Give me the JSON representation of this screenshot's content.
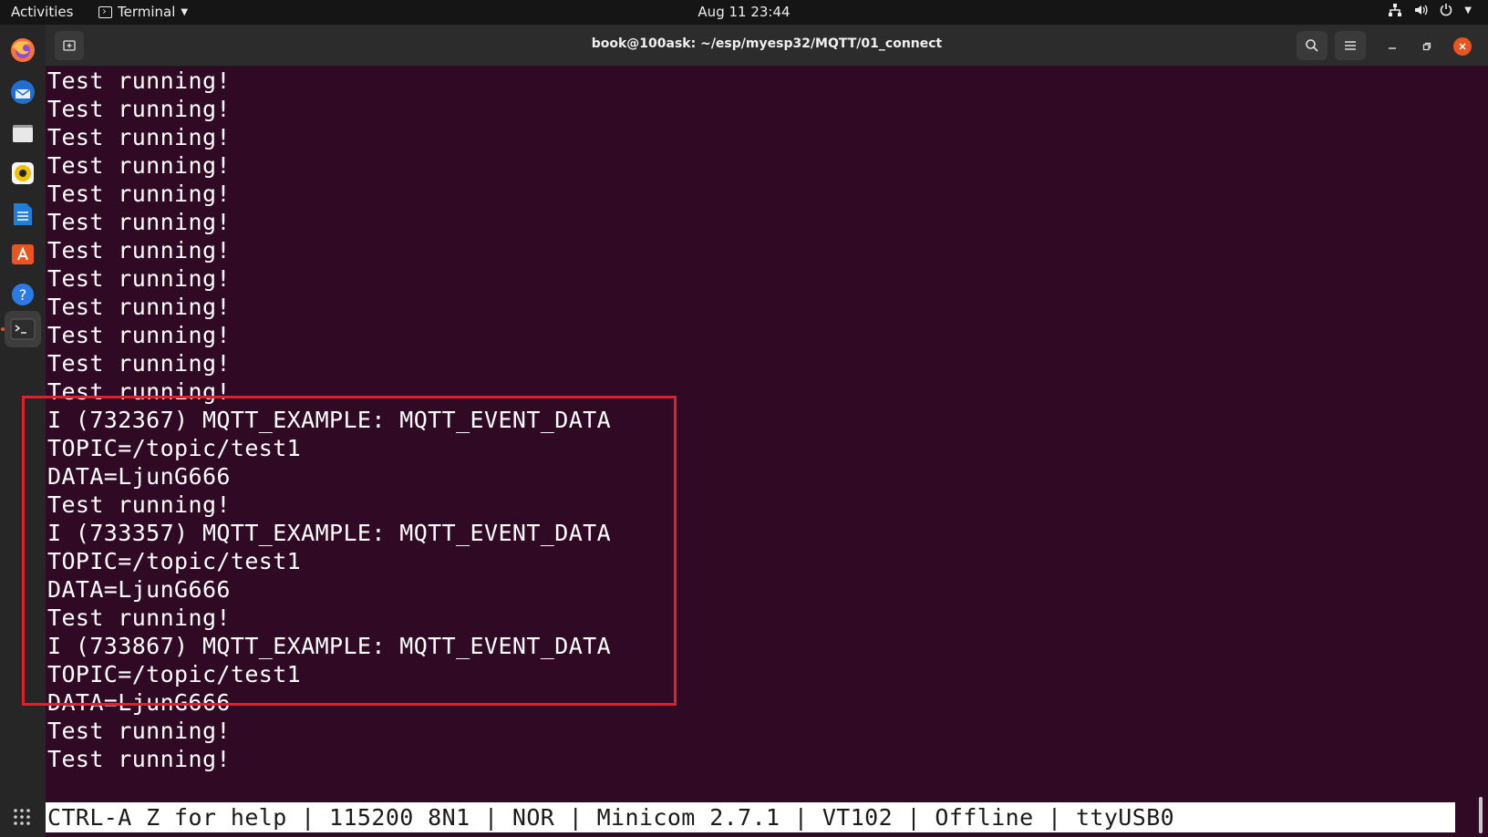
{
  "topbar": {
    "activities": "Activities",
    "app_menu": "Terminal",
    "clock": "Aug 11  23:44",
    "icons": [
      "network-icon",
      "volume-icon",
      "power-icon"
    ]
  },
  "dock": {
    "items": [
      "firefox-icon",
      "thunderbird-icon",
      "files-icon",
      "rhythmbox-icon",
      "writer-icon",
      "software-icon",
      "help-icon",
      "terminal-icon"
    ],
    "active": "terminal-icon",
    "app_grid": "show-applications-icon"
  },
  "window": {
    "title": "book@100ask: ~/esp/myesp32/MQTT/01_connect"
  },
  "terminal": {
    "lines": [
      "Test running!",
      "Test running!",
      "Test running!",
      "Test running!",
      "Test running!",
      "Test running!",
      "Test running!",
      "Test running!",
      "Test running!",
      "Test running!",
      "Test running!",
      "Test running!",
      "I (732367) MQTT_EXAMPLE: MQTT_EVENT_DATA",
      "TOPIC=/topic/test1",
      "DATA=LjunG666",
      "Test running!",
      "I (733357) MQTT_EXAMPLE: MQTT_EVENT_DATA",
      "TOPIC=/topic/test1",
      "DATA=LjunG666",
      "Test running!",
      "I (733867) MQTT_EXAMPLE: MQTT_EVENT_DATA",
      "TOPIC=/topic/test1",
      "DATA=LjunG666",
      "Test running!",
      "Test running!"
    ],
    "status": "CTRL-A Z for help | 115200 8N1 | NOR | Minicom 2.7.1 | VT102 | Offline | ttyUSB0"
  },
  "colors": {
    "terminal_bg": "#300a24",
    "highlight_border": "#e0202e",
    "close_button": "#e95420"
  }
}
